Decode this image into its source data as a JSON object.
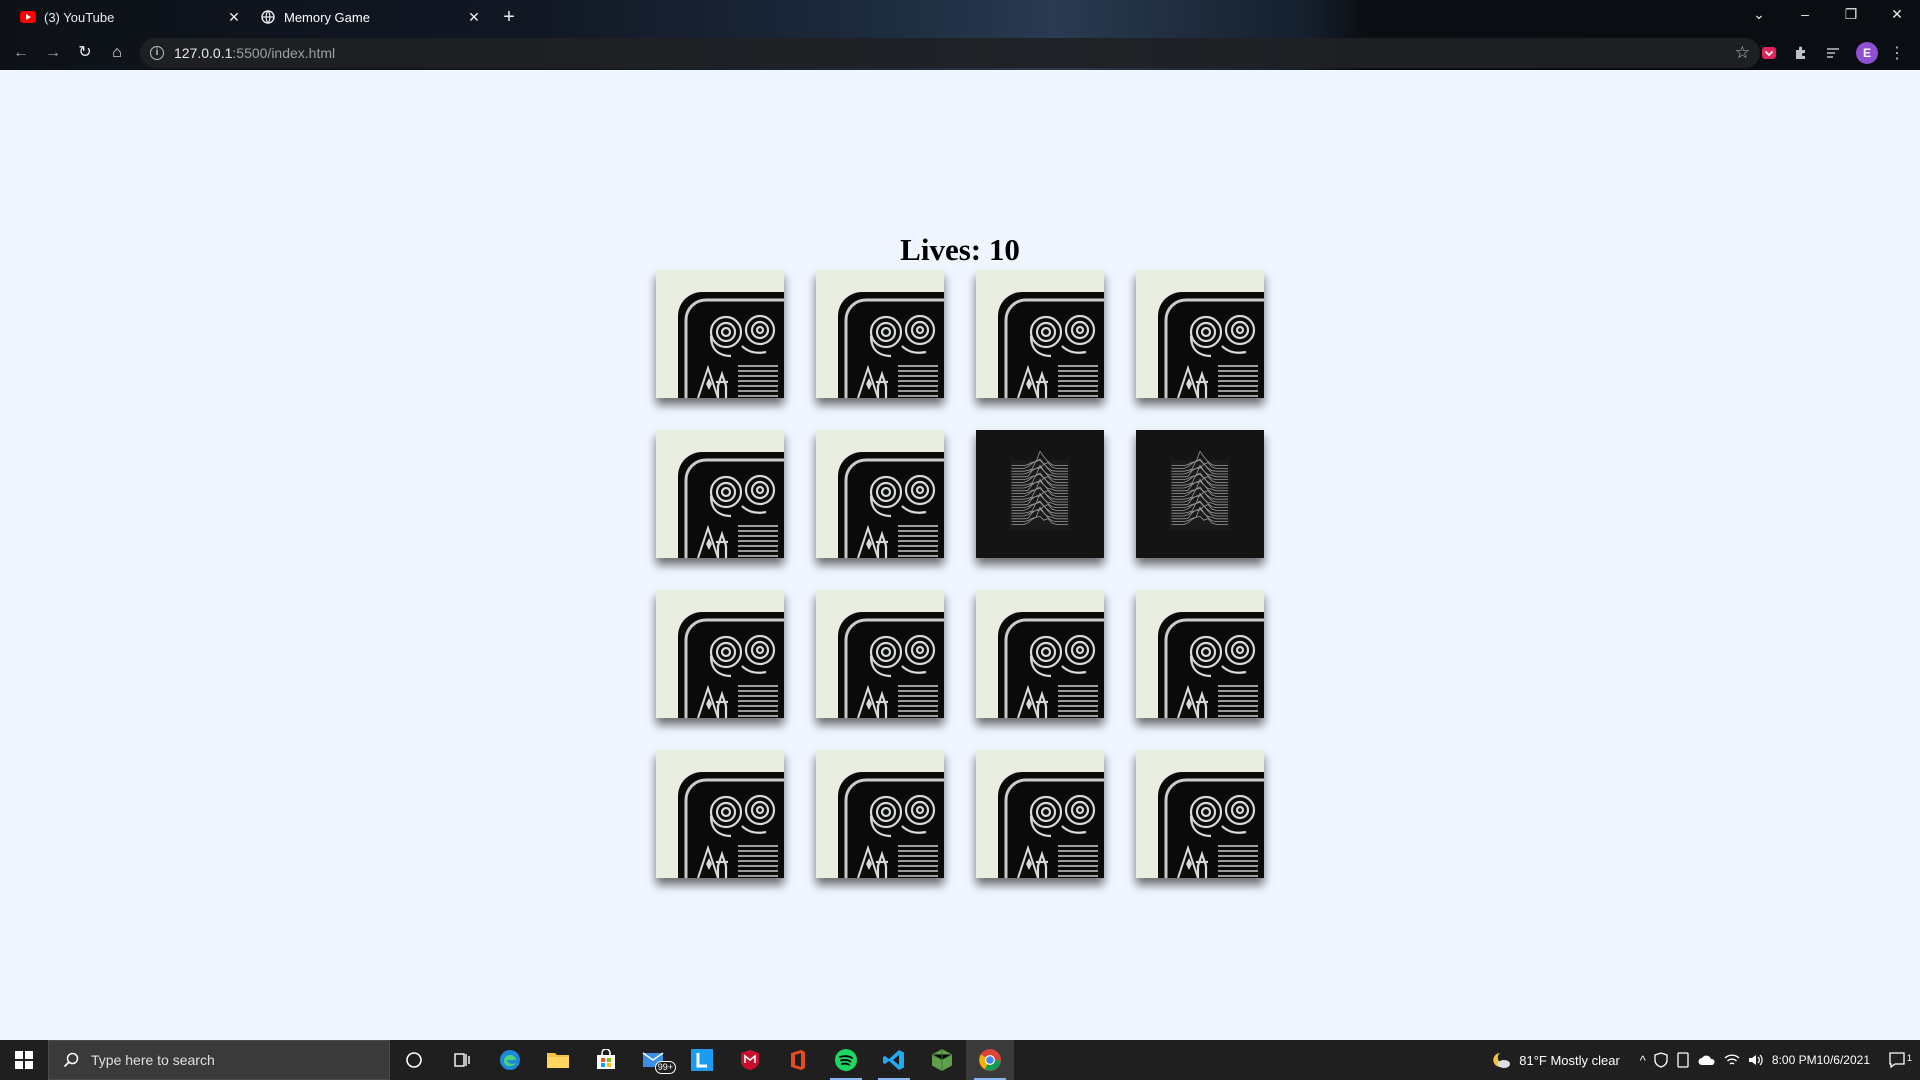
{
  "browser": {
    "tabs": [
      {
        "title": "(3) YouTube",
        "icon": "youtube-icon",
        "active": false
      },
      {
        "title": "Memory Game",
        "icon": "globe-icon",
        "active": true
      }
    ],
    "url_host": "127.0.0.1",
    "url_path": ":5500/index.html",
    "profile_initial": "E"
  },
  "game": {
    "lives_label": "Lives: 10",
    "cards": [
      {
        "face": "back"
      },
      {
        "face": "back"
      },
      {
        "face": "back"
      },
      {
        "face": "back"
      },
      {
        "face": "back"
      },
      {
        "face": "back"
      },
      {
        "face": "front-album"
      },
      {
        "face": "front-album"
      },
      {
        "face": "back"
      },
      {
        "face": "back"
      },
      {
        "face": "back"
      },
      {
        "face": "back"
      },
      {
        "face": "back"
      },
      {
        "face": "back"
      },
      {
        "face": "back"
      },
      {
        "face": "back"
      }
    ]
  },
  "taskbar": {
    "search_placeholder": "Type here to search",
    "badge_count": "99+",
    "weather": "81°F  Mostly clear",
    "time": "8:00 PM",
    "date": "10/6/2021",
    "notification_count": "1"
  },
  "colors": {
    "page_bg": "#eff6ff",
    "card_cream": "#eaeee0",
    "card_dark": "#0a0a0a",
    "taskbar_bg": "#1f1f1f",
    "accent": "#8ab4f8"
  }
}
